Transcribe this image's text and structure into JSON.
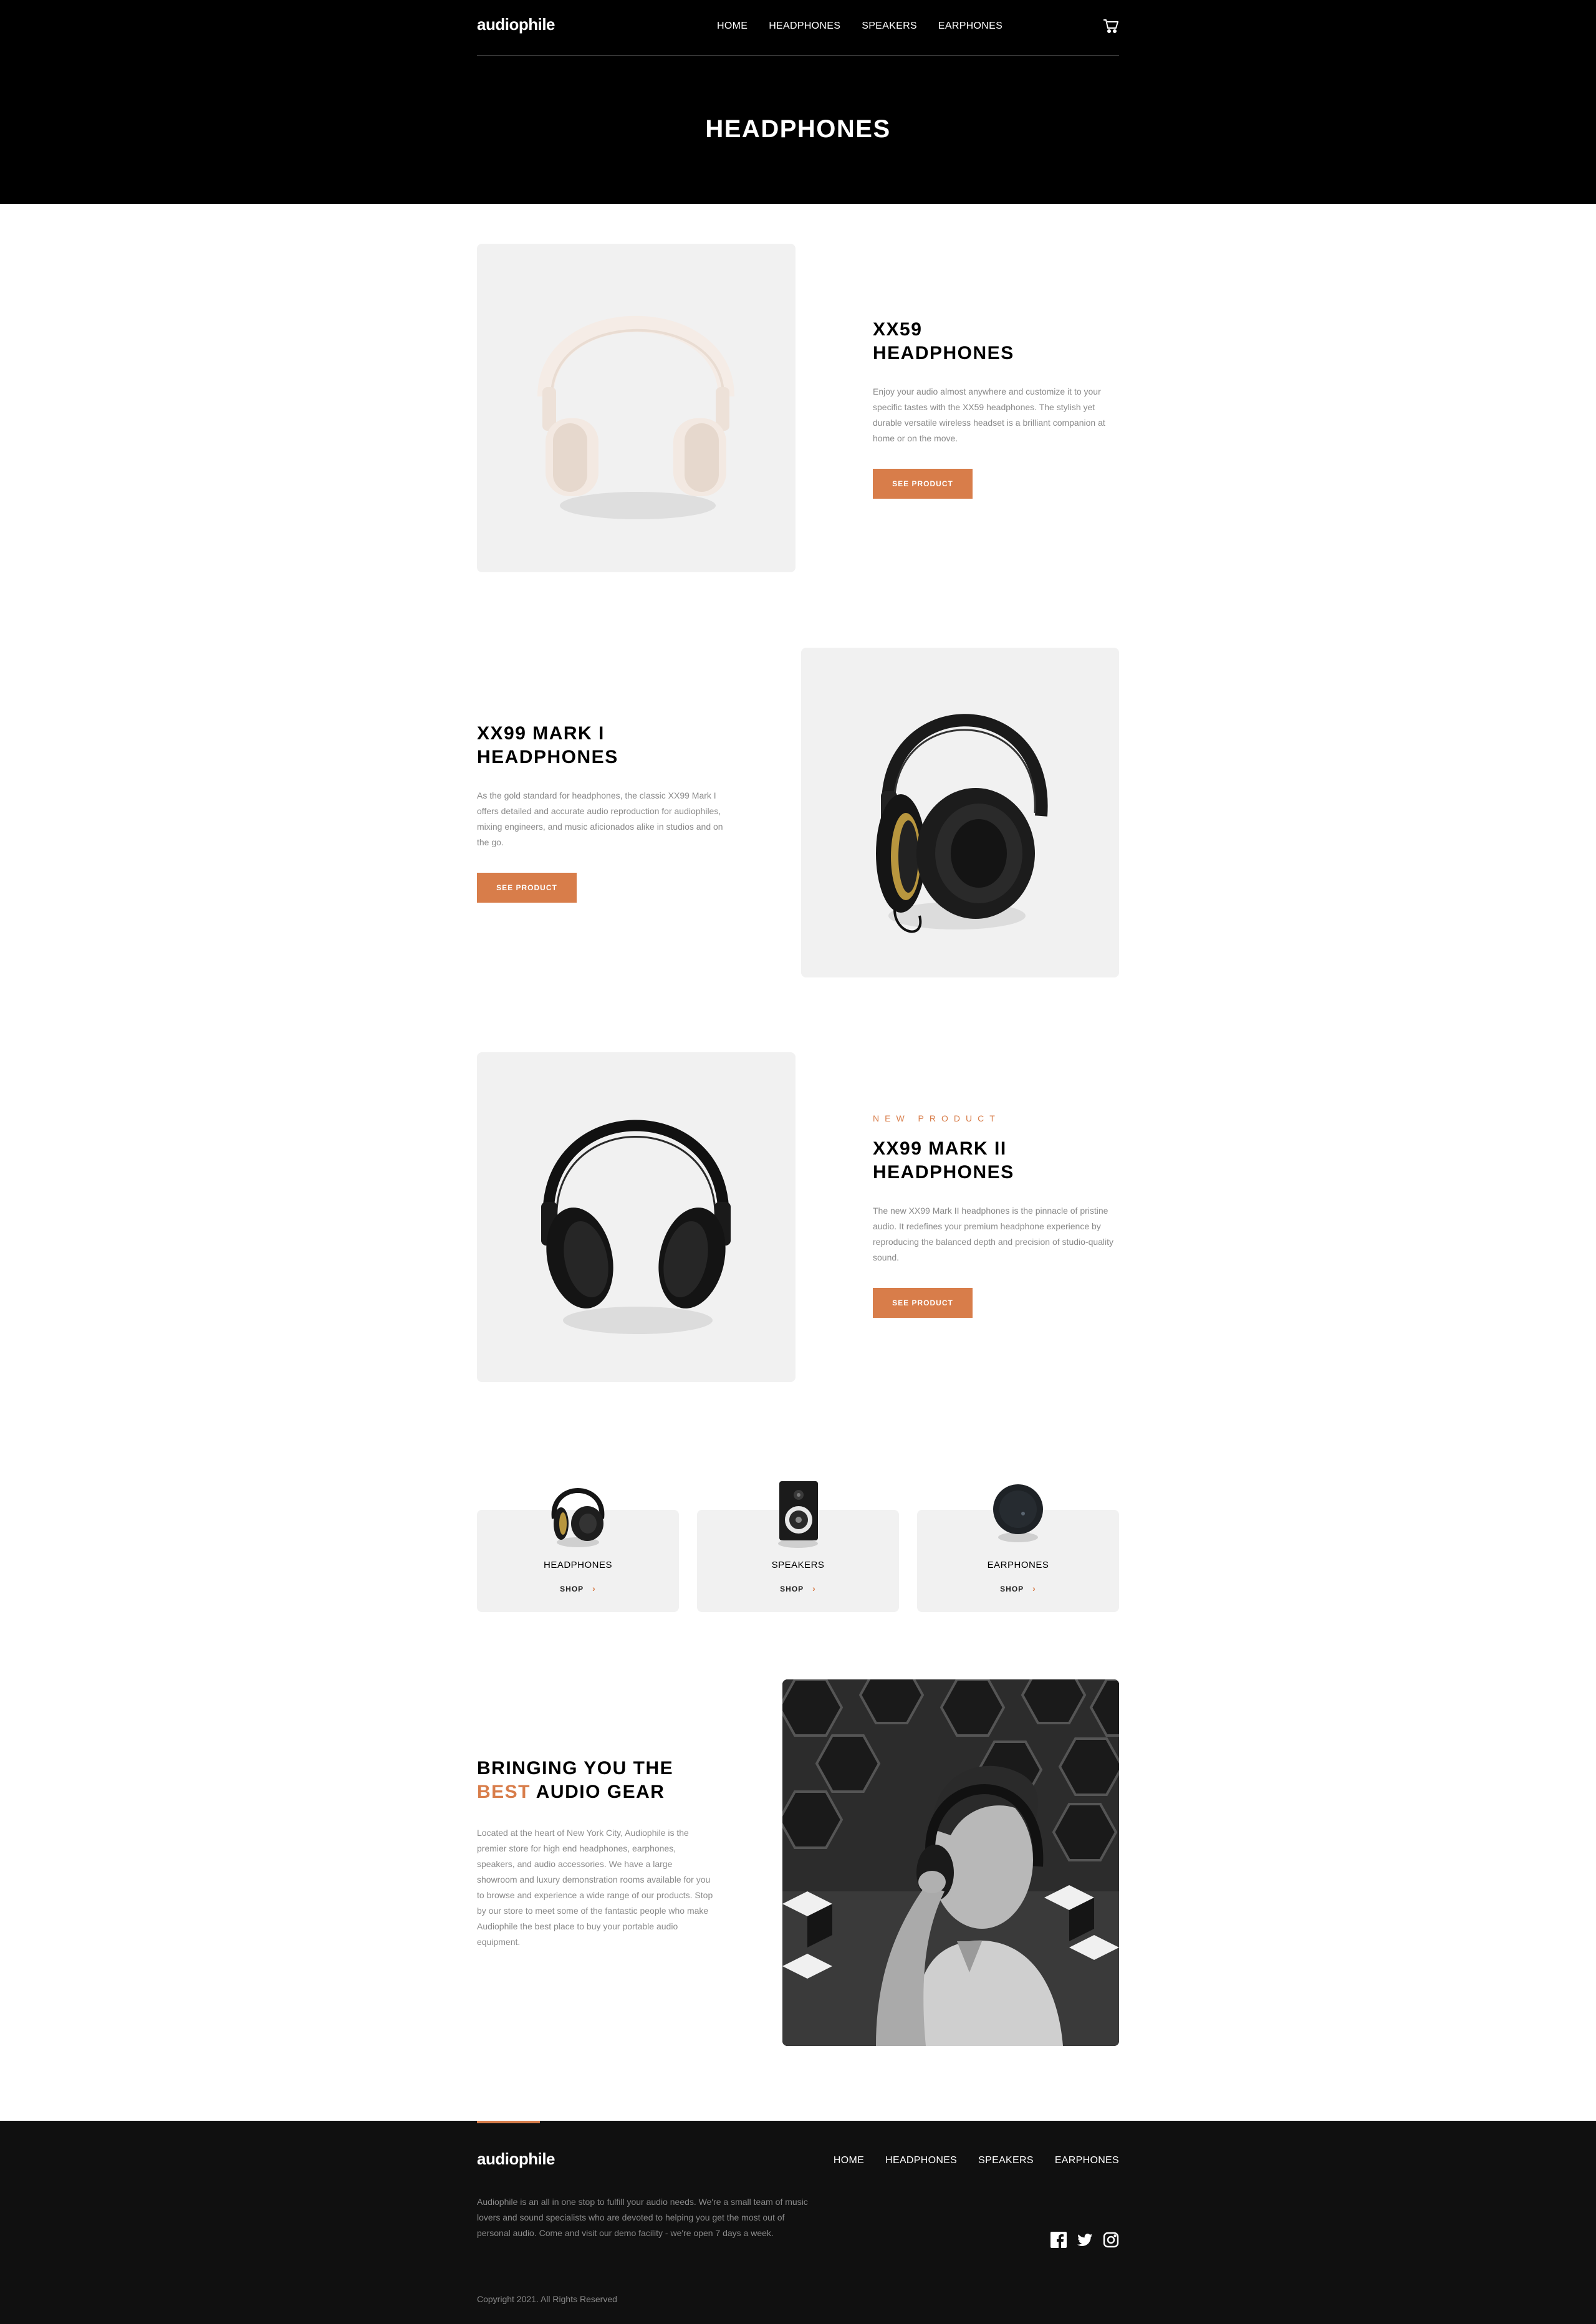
{
  "header": {
    "logo": "audiophile",
    "nav": [
      "HOME",
      "HEADPHONES",
      "SPEAKERS",
      "EARPHONES"
    ],
    "cart_icon": "cart-icon",
    "page_title": "HEADPHONES"
  },
  "products": [
    {
      "name_line1": "XX59",
      "name_line2": "HEADPHONES",
      "description": "Enjoy your audio almost anywhere and customize it to your specific tastes with the XX59 headphones. The stylish yet durable versatile wireless headset is a brilliant companion at home or on the move.",
      "button": "SEE PRODUCT"
    },
    {
      "name_line1": "XX99 MARK I",
      "name_line2": "HEADPHONES",
      "description": "As the gold standard for headphones, the classic XX99 Mark I offers detailed and accurate audio reproduction for audiophiles, mixing engineers, and music aficionados alike in studios and on the go.",
      "button": "SEE PRODUCT"
    },
    {
      "new_label": "NEW PRODUCT",
      "name_line1": "XX99 MARK II",
      "name_line2": "HEADPHONES",
      "description": "The new XX99 Mark II headphones is the pinnacle of pristine audio. It redefines your premium headphone experience by reproducing the balanced depth and precision of studio-quality sound.",
      "button": "SEE PRODUCT"
    }
  ],
  "categories": [
    {
      "name": "HEADPHONES",
      "shop": "SHOP"
    },
    {
      "name": "SPEAKERS",
      "shop": "SHOP"
    },
    {
      "name": "EARPHONES",
      "shop": "SHOP"
    }
  ],
  "about": {
    "title_line1": "BRINGING YOU THE",
    "title_accent": "BEST",
    "title_rest": "AUDIO GEAR",
    "description": "Located at the heart of New York City, Audiophile is the premier store for high end headphones, earphones, speakers, and audio accessories. We have a large showroom and luxury demonstration rooms available for you to browse and experience a wide range of our products. Stop by our store to meet some of the fantastic people who make Audiophile the best place to buy your portable audio equipment."
  },
  "footer": {
    "logo": "audiophile",
    "nav": [
      "HOME",
      "HEADPHONES",
      "SPEAKERS",
      "EARPHONES"
    ],
    "description": "Audiophile is an all in one stop to fulfill your audio needs. We're a small team of music lovers and sound specialists who are devoted to helping you get the most out of personal audio. Come and visit our demo facility - we're open 7 days a week.",
    "copyright": "Copyright 2021. All Rights Reserved",
    "socials": [
      "facebook-icon",
      "twitter-icon",
      "instagram-icon"
    ]
  },
  "colors": {
    "accent": "#d87d4a",
    "dark": "#000000",
    "footer": "#101010",
    "card": "#f1f1f1"
  }
}
